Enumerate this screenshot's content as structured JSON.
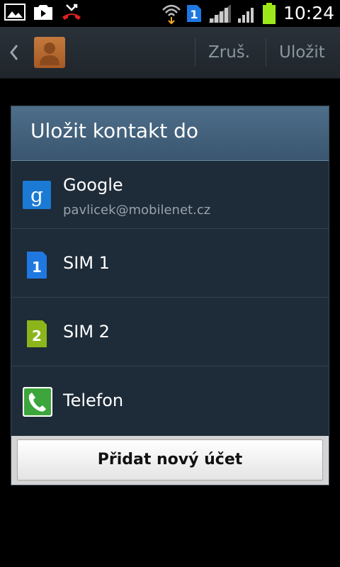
{
  "status_bar": {
    "time": "10:24",
    "sim_indicator": "1",
    "icons": [
      "gallery-icon",
      "media-icon",
      "missed-call-icon",
      "wifi-icon",
      "sim-icon",
      "signal-icon",
      "signal-icon",
      "battery-icon"
    ],
    "battery_color": "#9ee81a"
  },
  "action_bar": {
    "cancel_label": "Zruš.",
    "save_label": "Uložit"
  },
  "dialog": {
    "title": "Uložit kontakt do",
    "accounts": [
      {
        "label": "Google",
        "sublabel": "pavlicek@mobilenet.cz",
        "icon": "google-icon"
      },
      {
        "label": "SIM 1",
        "icon": "sim1-icon",
        "badge": "1"
      },
      {
        "label": "SIM 2",
        "icon": "sim2-icon",
        "badge": "2"
      },
      {
        "label": "Telefon",
        "icon": "phone-icon"
      }
    ],
    "add_account_label": "Přidat nový účet"
  }
}
